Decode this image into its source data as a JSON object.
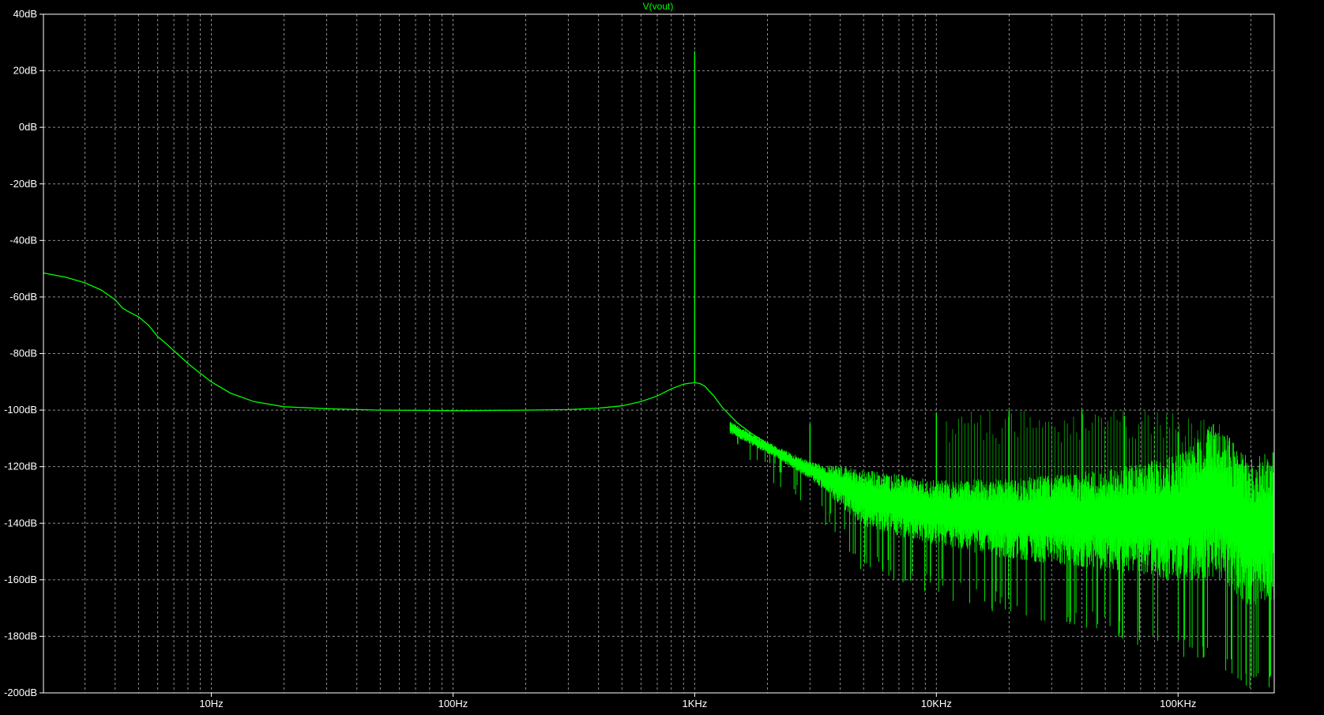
{
  "trace_label": "V(vout)",
  "colors": {
    "background": "#000000",
    "grid": "#8c8c8c",
    "frame": "#ffffff",
    "trace": "#00ff00",
    "text": "#ffffff"
  },
  "chart_data": {
    "type": "line",
    "title": "V(vout)",
    "xlabel": "",
    "ylabel": "",
    "x_scale": "log",
    "xlim": [
      2.02,
      250000
    ],
    "ylim": [
      -200,
      40
    ],
    "grid": true,
    "x_tick_labels": [
      "10Hz",
      "100Hz",
      "1KHz",
      "10KHz",
      "100KHz"
    ],
    "x_tick_values": [
      10,
      100,
      1000,
      10000,
      100000
    ],
    "y_tick_labels": [
      "40dB",
      "20dB",
      "0dB",
      "-20dB",
      "-40dB",
      "-60dB",
      "-80dB",
      "-100dB",
      "-120dB",
      "-140dB",
      "-160dB",
      "-180dB",
      "-200dB"
    ],
    "y_tick_values": [
      40,
      20,
      0,
      -20,
      -40,
      -60,
      -80,
      -100,
      -120,
      -140,
      -160,
      -180,
      -200
    ],
    "series": [
      {
        "name": "V(vout)",
        "x": [
          2.02,
          2.5,
          3,
          3.5,
          4,
          4.3,
          4.5,
          5,
          5.5,
          6,
          6.5,
          7,
          8,
          9,
          10,
          12,
          15,
          20,
          25,
          30,
          40,
          50,
          70,
          100,
          150,
          200,
          300,
          400,
          500,
          600,
          700,
          800,
          900,
          950,
          1000,
          1050,
          1100,
          1200,
          1300,
          1500,
          1700,
          2000,
          2500,
          3000,
          4000,
          5000,
          7000,
          10000,
          15000,
          20000,
          30000,
          50000,
          70000,
          100000,
          120000,
          140000,
          150000,
          170000,
          200000,
          230000,
          250000
        ],
        "y": [
          -51.5,
          -53,
          -55,
          -57.5,
          -61,
          -64,
          -65,
          -67,
          -70,
          -74,
          -76.5,
          -79,
          -83.5,
          -87,
          -90,
          -94,
          -97,
          -98.8,
          -99.2,
          -99.5,
          -99.8,
          -100,
          -100.1,
          -100.2,
          -100.1,
          -100,
          -99.8,
          -99.3,
          -98.5,
          -97,
          -95,
          -92.5,
          -90.8,
          -90.5,
          -90.3,
          -90.6,
          -91.5,
          -95,
          -99,
          -104.5,
          -108,
          -112,
          -117,
          -121,
          -126,
          -130,
          -133,
          -135,
          -136,
          -136.5,
          -136.5,
          -137,
          -136.5,
          -135,
          -132,
          -128,
          -130,
          -137,
          -141,
          -142,
          -128
        ]
      }
    ],
    "spikes": [
      {
        "x": 1000,
        "y": 27
      },
      {
        "x": 3000,
        "y": -105
      },
      {
        "x": 10000,
        "y": -101
      },
      {
        "x": 20000,
        "y": -100
      },
      {
        "x": 40000,
        "y": -100
      },
      {
        "x": 60000,
        "y": -102
      },
      {
        "x": 100000,
        "y": -108
      },
      {
        "x": 140000,
        "y": -105
      }
    ],
    "noise_band": {
      "x_start": 1400,
      "x_end": 250000,
      "center_db": [
        [
          1400,
          -106
        ],
        [
          2000,
          -113
        ],
        [
          3000,
          -121
        ],
        [
          5000,
          -130
        ],
        [
          10000,
          -135
        ],
        [
          20000,
          -137
        ],
        [
          50000,
          -137
        ],
        [
          100000,
          -136
        ],
        [
          140000,
          -129
        ],
        [
          150000,
          -131
        ],
        [
          200000,
          -141
        ],
        [
          250000,
          -138
        ]
      ],
      "lower_db": [
        [
          1400,
          -108
        ],
        [
          3000,
          -127
        ],
        [
          5000,
          -150
        ],
        [
          10000,
          -158
        ],
        [
          20000,
          -165
        ],
        [
          50000,
          -172
        ],
        [
          100000,
          -180
        ],
        [
          150000,
          -185
        ],
        [
          200000,
          -193
        ],
        [
          250000,
          -190
        ]
      ]
    }
  }
}
